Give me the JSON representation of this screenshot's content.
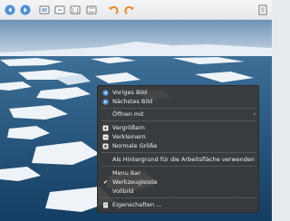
{
  "toolbar": {
    "buttons": [
      {
        "name": "previous-image-button",
        "icon": "arrow-left-icon"
      },
      {
        "name": "next-image-button",
        "icon": "arrow-right-icon"
      },
      {
        "name": "zoom-in-button",
        "icon": "zoom-in-icon"
      },
      {
        "name": "zoom-out-button",
        "icon": "zoom-out-icon"
      },
      {
        "name": "original-size-button",
        "icon": "original-size-icon"
      },
      {
        "name": "fit-window-button",
        "icon": "fit-window-icon"
      },
      {
        "name": "rotate-left-button",
        "icon": "rotate-left-icon"
      },
      {
        "name": "rotate-right-button",
        "icon": "rotate-right-icon"
      },
      {
        "name": "properties-button",
        "icon": "properties-icon"
      }
    ]
  },
  "context_menu": {
    "items": {
      "prev": "Voriges Bild",
      "next": "Nächstes Bild",
      "open_with": "Öffnen mit",
      "zoom_in": "Vergrößern",
      "zoom_out": "Verkleinern",
      "normal_size": "Normale Größe",
      "set_background": "Als Hintergrund für die Arbeitsfläche verwenden",
      "menu_bar": "Menu Bar",
      "toolbar": "Werkzeugleiste",
      "fullscreen": "Vollbild",
      "properties": "Eigenschaften ..."
    },
    "checked": {
      "toolbar": true
    },
    "submenu_arrow": "›",
    "check_mark": "✔"
  },
  "colors": {
    "menu_bg": "#3a3a3a",
    "icon_blue": "#4a8fd6",
    "icon_orange": "#e8882a"
  }
}
